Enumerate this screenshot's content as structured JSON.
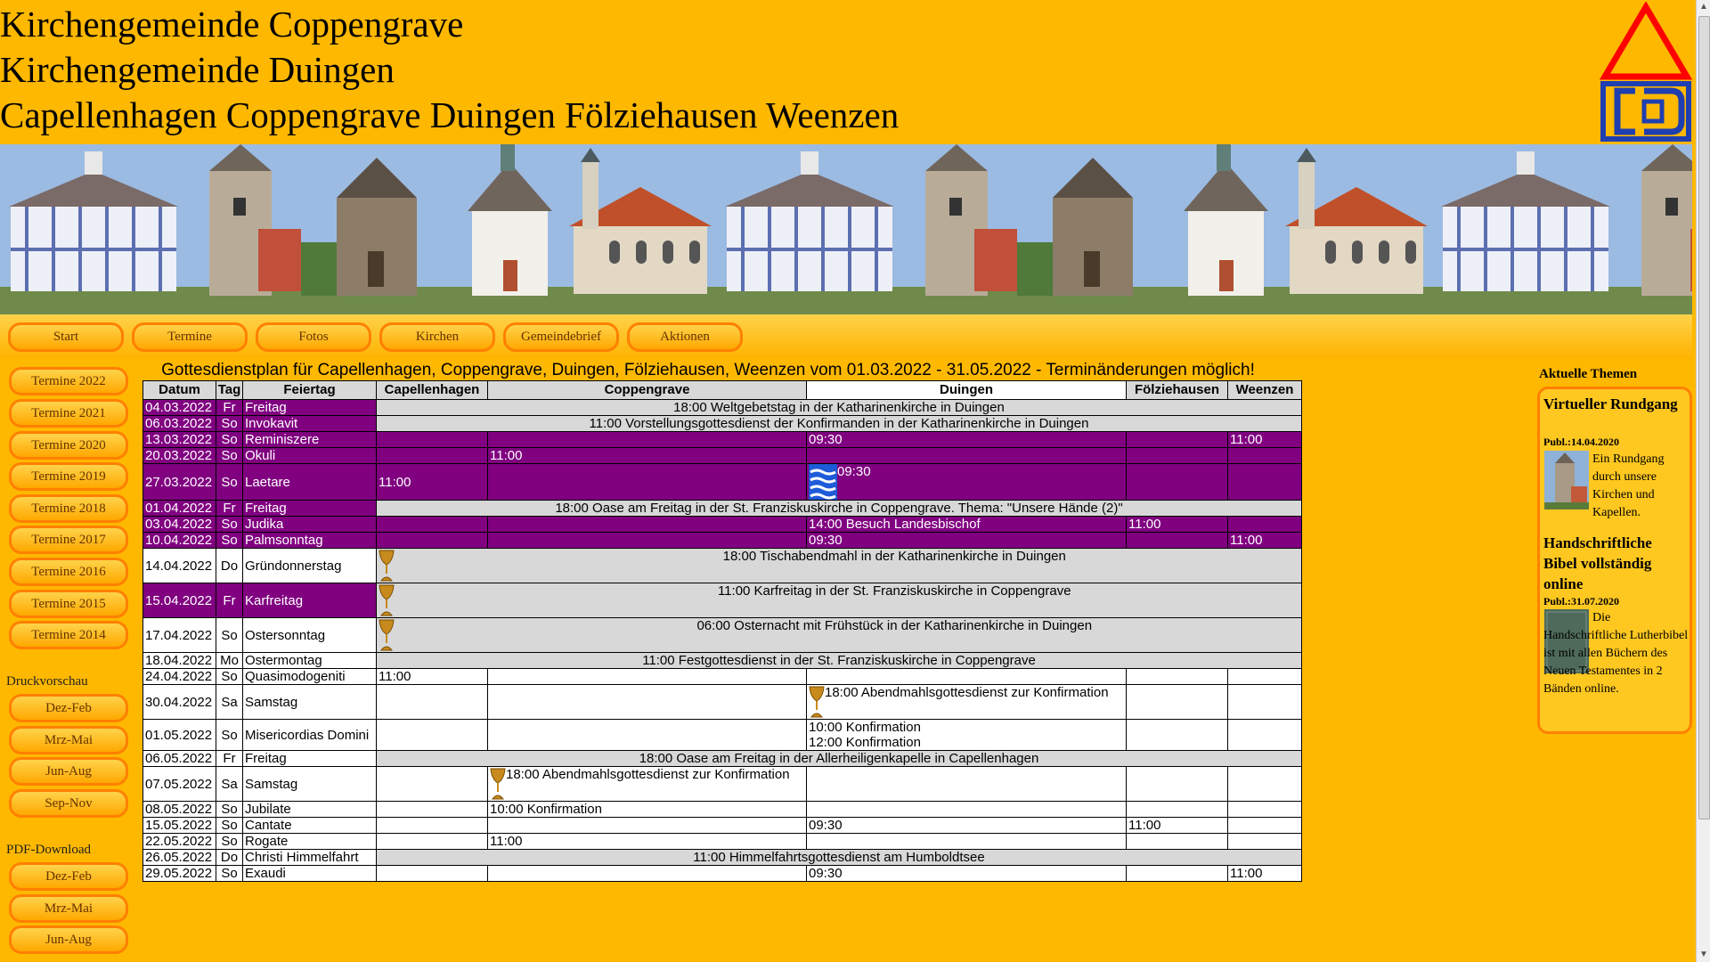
{
  "header": {
    "titles": [
      "Kirchengemeinde Coppengrave",
      "Kirchengemeinde Duingen",
      "Capellenhagen Coppengrave Duingen Fölziehausen Weenzen"
    ]
  },
  "nav": [
    "Start",
    "Termine",
    "Fotos",
    "Kirchen",
    "Gemeindebrief",
    "Aktionen"
  ],
  "sidebar": {
    "termine": [
      "Termine 2022",
      "Termine 2021",
      "Termine 2020",
      "Termine 2019",
      "Termine 2018",
      "Termine 2017",
      "Termine 2016",
      "Termine 2015",
      "Termine 2014"
    ],
    "druck_title": "Druckvorschau",
    "druck": [
      "Dez-Feb",
      "Mrz-Mai",
      "Jun-Aug",
      "Sep-Nov"
    ],
    "pdf_title": "PDF-Download",
    "pdf": [
      "Dez-Feb",
      "Mrz-Mai",
      "Jun-Aug"
    ]
  },
  "schedule": {
    "title": "Gottesdienstplan für Capellenhagen, Coppengrave, Duingen, Fölziehausen, Weenzen vom 01.03.2022 - 31.05.2022 - Terminänderungen möglich!",
    "headers": [
      "Datum",
      "Tag",
      "Feiertag",
      "Capellenhagen",
      "Coppengrave",
      "Duingen",
      "Fölziehausen",
      "Weenzen"
    ],
    "rows": [
      {
        "date": "04.03.2022",
        "day": "Fr",
        "holiday": "Freitag",
        "style": "purple",
        "span": "18:00 Weltgebetstag in der Katharinenkirche in Duingen"
      },
      {
        "date": "06.03.2022",
        "day": "So",
        "holiday": "Invokavit",
        "style": "purple",
        "span": "11:00 Vorstellungsgottesdienst der Konfirmanden in der Katharinenkirche in Duingen"
      },
      {
        "date": "13.03.2022",
        "day": "So",
        "holiday": "Reminiszere",
        "style": "purple",
        "cells": [
          "",
          "",
          "09:30",
          "",
          "11:00"
        ]
      },
      {
        "date": "20.03.2022",
        "day": "So",
        "holiday": "Okuli",
        "style": "purple",
        "cells": [
          "",
          "11:00",
          "",
          "",
          ""
        ]
      },
      {
        "date": "27.03.2022",
        "day": "So",
        "holiday": "Laetare",
        "style": "purple",
        "tall": true,
        "cells": [
          "11:00",
          "",
          "09:30",
          "",
          ""
        ],
        "icons": {
          "2": "baptism-icon"
        }
      },
      {
        "date": "01.04.2022",
        "day": "Fr",
        "holiday": "Freitag",
        "style": "purple",
        "span": "18:00 Oase am Freitag in der St. Franziskuskirche in Coppengrave. Thema: \"Unsere Hände (2)\""
      },
      {
        "date": "03.04.2022",
        "day": "So",
        "holiday": "Judika",
        "style": "purple",
        "cells": [
          "",
          "",
          "14:00 Besuch Landesbischof",
          "11:00",
          ""
        ]
      },
      {
        "date": "10.04.2022",
        "day": "So",
        "holiday": "Palmsonntag",
        "style": "purple",
        "cells": [
          "",
          "",
          "09:30",
          "",
          "11:00"
        ]
      },
      {
        "date": "14.04.2022",
        "day": "Do",
        "holiday": "Gründonnerstag",
        "style": "white",
        "tall": true,
        "cupFirst": true,
        "span": "18:00 Tischabendmahl in der Katharinenkirche in Duingen"
      },
      {
        "date": "15.04.2022",
        "day": "Fr",
        "holiday": "Karfreitag",
        "style": "purple",
        "tall": true,
        "cupFirst": true,
        "span": "11:00 Karfreitag in der St. Franziskuskirche in Coppengrave"
      },
      {
        "date": "17.04.2022",
        "day": "So",
        "holiday": "Ostersonntag",
        "style": "white",
        "tall": true,
        "cupFirst": true,
        "span": "06:00 Osternacht mit Frühstück in der Katharinenkirche in Duingen"
      },
      {
        "date": "18.04.2022",
        "day": "Mo",
        "holiday": "Ostermontag",
        "style": "white",
        "span": "11:00 Festgottesdienst in der St. Franziskuskirche in Coppengrave"
      },
      {
        "date": "24.04.2022",
        "day": "So",
        "holiday": "Quasimodogeniti",
        "style": "white",
        "cells": [
          "11:00",
          "",
          "",
          "",
          ""
        ]
      },
      {
        "date": "30.04.2022",
        "day": "Sa",
        "holiday": "Samstag",
        "style": "white",
        "tall": true,
        "cells": [
          "",
          "",
          "18:00 Abendmahlsgottesdienst zur Konfirmation",
          "",
          ""
        ],
        "icons": {
          "2": "chalice-icon"
        }
      },
      {
        "date": "01.05.2022",
        "day": "So",
        "holiday": "Misericordias Domini",
        "style": "white",
        "tall": true,
        "cells": [
          "",
          "",
          "10:00 Konfirmation|12:00 Konfirmation",
          "",
          ""
        ]
      },
      {
        "date": "06.05.2022",
        "day": "Fr",
        "holiday": "Freitag",
        "style": "white",
        "span": "18:00 Oase am Freitag in der Allerheiligenkapelle in Capellenhagen"
      },
      {
        "date": "07.05.2022",
        "day": "Sa",
        "holiday": "Samstag",
        "style": "white",
        "tall": true,
        "cells": [
          "",
          "18:00 Abendmahlsgottesdienst zur Konfirmation",
          "",
          "",
          ""
        ],
        "icons": {
          "1": "chalice-icon"
        }
      },
      {
        "date": "08.05.2022",
        "day": "So",
        "holiday": "Jubilate",
        "style": "white",
        "cells": [
          "",
          "10:00 Konfirmation",
          "",
          "",
          ""
        ]
      },
      {
        "date": "15.05.2022",
        "day": "So",
        "holiday": "Cantate",
        "style": "white",
        "cells": [
          "",
          "",
          "09:30",
          "11:00",
          ""
        ]
      },
      {
        "date": "22.05.2022",
        "day": "So",
        "holiday": "Rogate",
        "style": "white",
        "cells": [
          "",
          "11:00",
          "",
          "",
          ""
        ]
      },
      {
        "date": "26.05.2022",
        "day": "Do",
        "holiday": "Christi Himmelfahrt",
        "style": "white",
        "span": "11:00 Himmelfahrtsgottesdienst am Humboldtsee"
      },
      {
        "date": "29.05.2022",
        "day": "So",
        "holiday": "Exaudi",
        "style": "white",
        "cells": [
          "",
          "",
          "09:30",
          "",
          "11:00"
        ]
      }
    ]
  },
  "rightbar": {
    "title": "Aktuelle Themen",
    "item1_head": "Virtueller Rundgang",
    "item1_date": "Publ.:14.04.2020",
    "item1_text": "Ein Rundgang durch unsere Kirchen und Kapellen.",
    "item2_head": "Handschriftliche Bibel vollständig online",
    "item2_date": "Publ.:31.07.2020",
    "item2_text": "Die Handschriftliche Lutherbibel ist mit allen Büchern des Neuen Testamentes in 2 Bänden online."
  },
  "colors": {
    "background": "#ffb800",
    "purple": "#800080",
    "button_border": "#ff8000",
    "logo_red": "#ff0000",
    "logo_blue": "#1f3fb0"
  }
}
